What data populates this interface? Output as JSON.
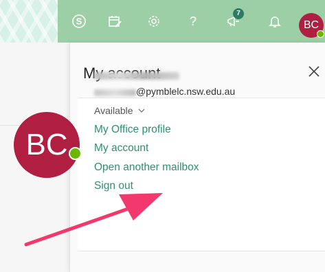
{
  "top_bar": {
    "notification_count": "7",
    "avatar_initials": "BC",
    "icons": [
      "skype-icon",
      "calendar-edit-icon",
      "gear-icon",
      "help-icon",
      "megaphone-icon",
      "bell-icon"
    ],
    "accent_color": "#9dcfa6"
  },
  "panel": {
    "title": "My account",
    "close_label": "✕"
  },
  "account": {
    "avatar_initials": "BC",
    "email_domain": "@pymblelc.nsw.edu.au",
    "presence": "Available",
    "links": [
      "My Office profile",
      "My account",
      "Open another mailbox",
      "Sign out"
    ]
  },
  "colors": {
    "avatar_bg": "#b01e42",
    "link_color": "#2f8f6f",
    "presence_dot": "#6bb700",
    "annotation_arrow": "#f2386c"
  }
}
